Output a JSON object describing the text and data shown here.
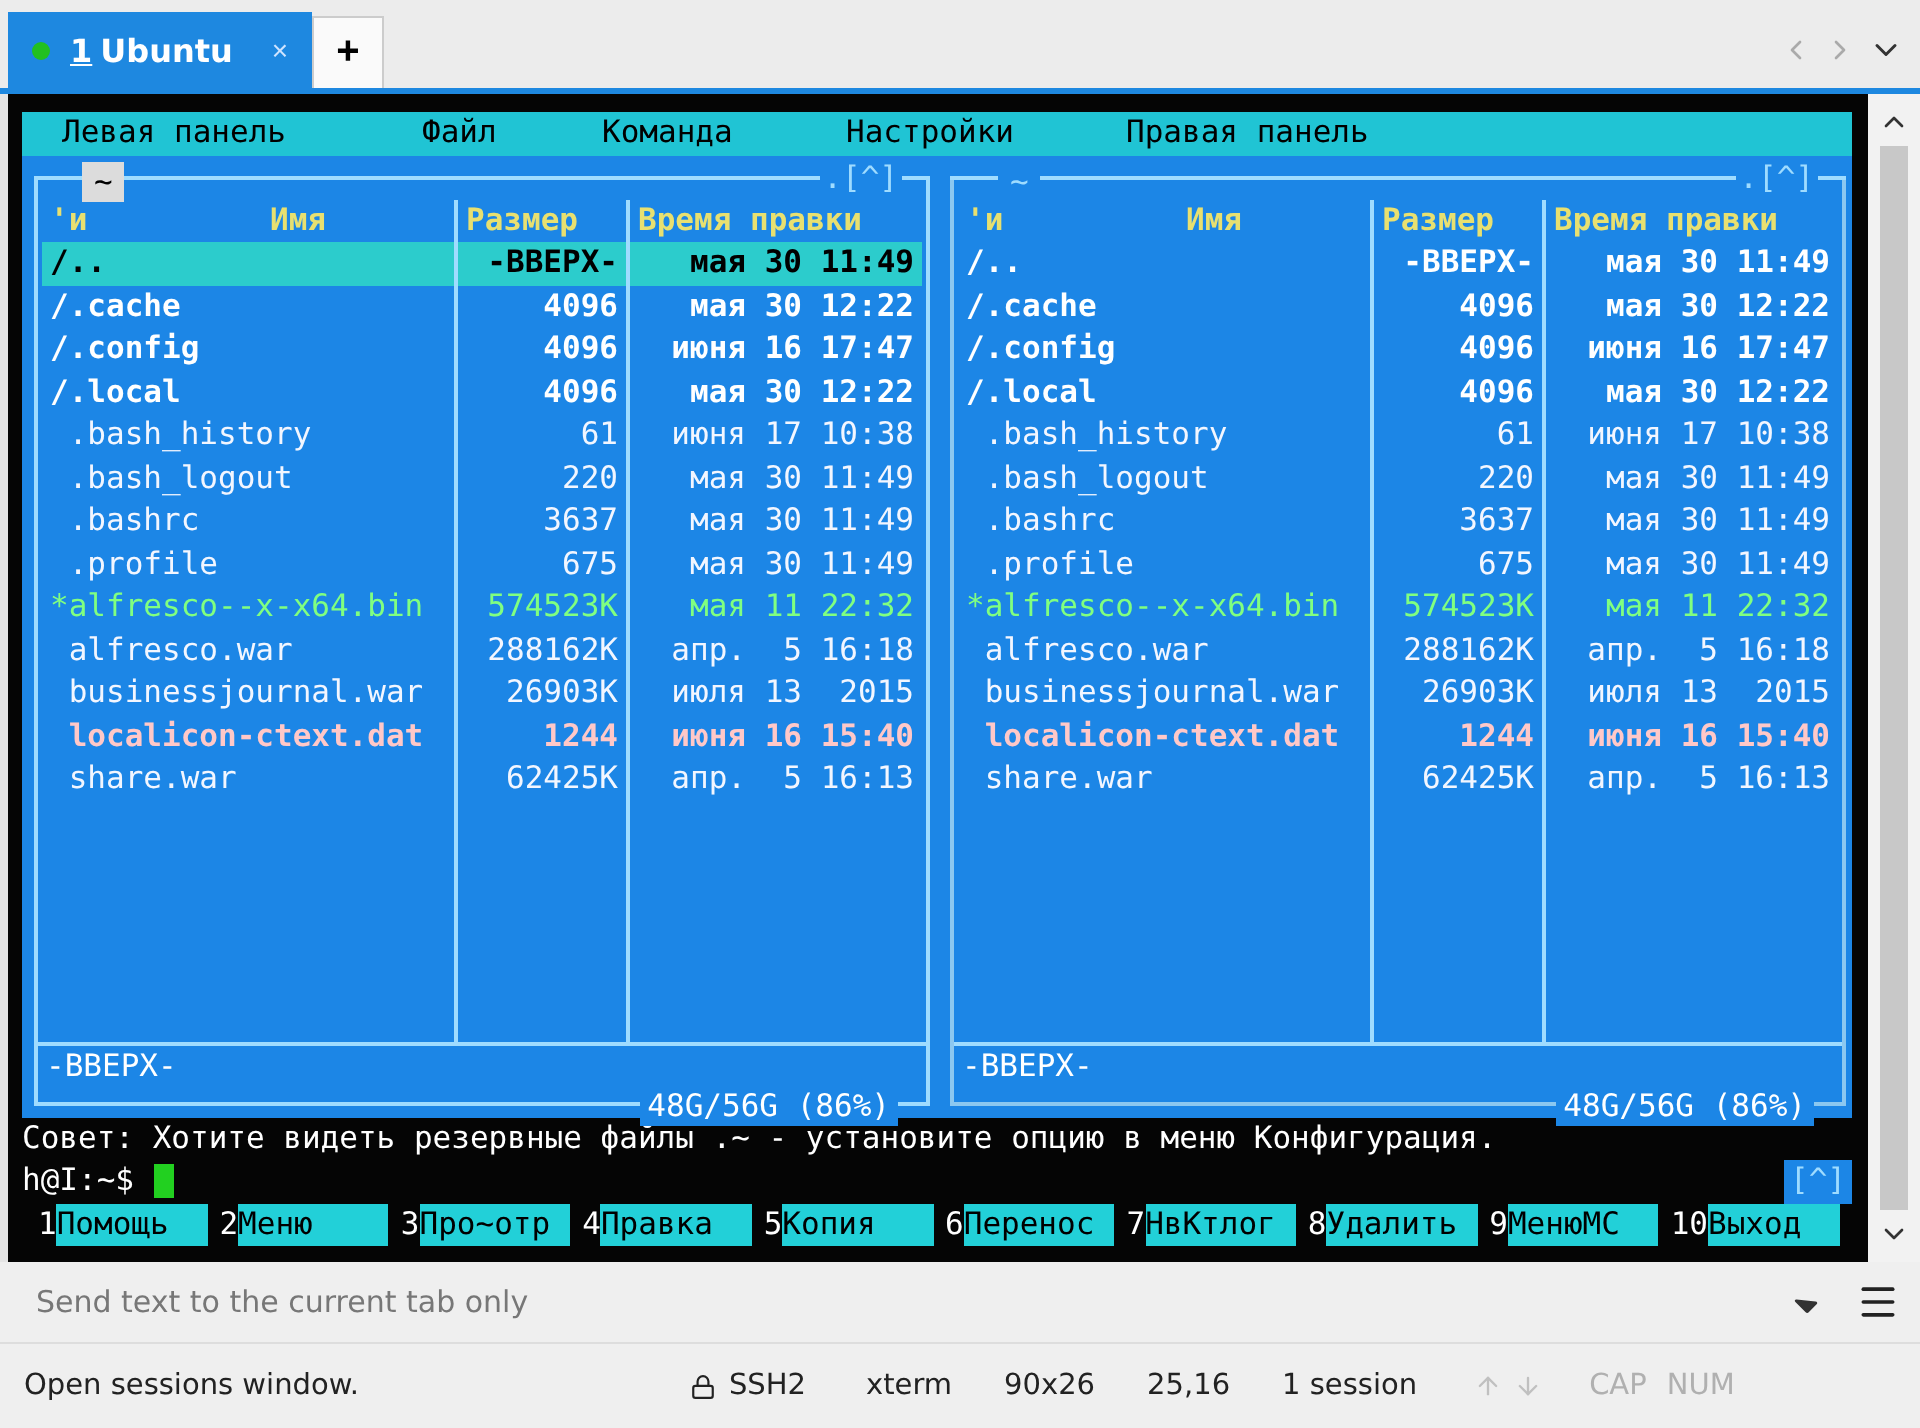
{
  "tab": {
    "index": "1",
    "label": "Ubuntu",
    "close": "×",
    "connected": true
  },
  "new_tab": "+",
  "menu": [
    "Левая панель",
    "Файл",
    "Команда",
    "Настройки",
    "Правая панель"
  ],
  "panels": [
    {
      "active": true,
      "path": "~",
      "corner": ".[^]",
      "columns": [
        "'и",
        "Имя",
        "Размер",
        "Время правки"
      ],
      "footer": "-ВВЕРХ-",
      "disk": "48G/56G (86%)",
      "rows": [
        {
          "kind": "dir",
          "name": "/..",
          "size": "-ВВЕРХ-",
          "time": "мая 30 11:49",
          "selected": true
        },
        {
          "kind": "dir",
          "name": "/.cache",
          "size": "4096",
          "time": "мая 30 12:22",
          "selected": false
        },
        {
          "kind": "dir",
          "name": "/.config",
          "size": "4096",
          "time": "июня 16 17:47",
          "selected": false
        },
        {
          "kind": "dir",
          "name": "/.local",
          "size": "4096",
          "time": "мая 30 12:22",
          "selected": false
        },
        {
          "kind": "file",
          "name": " .bash_history",
          "size": "61",
          "time": "июня 17 10:38",
          "selected": false
        },
        {
          "kind": "file",
          "name": " .bash_logout",
          "size": "220",
          "time": "мая 30 11:49",
          "selected": false
        },
        {
          "kind": "file",
          "name": " .bashrc",
          "size": "3637",
          "time": "мая 30 11:49",
          "selected": false
        },
        {
          "kind": "file",
          "name": " .profile",
          "size": "675",
          "time": "мая 30 11:49",
          "selected": false
        },
        {
          "kind": "exec",
          "name": "*alfresco--x-x64.bin",
          "size": "574523K",
          "time": "мая 11 22:32",
          "selected": false
        },
        {
          "kind": "file",
          "name": " alfresco.war",
          "size": "288162K",
          "time": "апр.  5 16:18",
          "selected": false
        },
        {
          "kind": "file",
          "name": " businessjournal.war",
          "size": "26903K",
          "time": "июля 13  2015",
          "selected": false
        },
        {
          "kind": "broken",
          "name": " localicon-ctext.dat",
          "size": "1244",
          "time": "июня 16 15:40",
          "selected": false
        },
        {
          "kind": "file",
          "name": " share.war",
          "size": "62425K",
          "time": "апр.  5 16:13",
          "selected": false
        }
      ]
    },
    {
      "active": false,
      "path": "~",
      "corner": ".[^]",
      "columns": [
        "'и",
        "Имя",
        "Размер",
        "Время правки"
      ],
      "footer": "-ВВЕРХ-",
      "disk": "48G/56G (86%)",
      "rows": [
        {
          "kind": "dir",
          "name": "/..",
          "size": "-ВВЕРХ-",
          "time": "мая 30 11:49",
          "selected": false
        },
        {
          "kind": "dir",
          "name": "/.cache",
          "size": "4096",
          "time": "мая 30 12:22",
          "selected": false
        },
        {
          "kind": "dir",
          "name": "/.config",
          "size": "4096",
          "time": "июня 16 17:47",
          "selected": false
        },
        {
          "kind": "dir",
          "name": "/.local",
          "size": "4096",
          "time": "мая 30 12:22",
          "selected": false
        },
        {
          "kind": "file",
          "name": " .bash_history",
          "size": "61",
          "time": "июня 17 10:38",
          "selected": false
        },
        {
          "kind": "file",
          "name": " .bash_logout",
          "size": "220",
          "time": "мая 30 11:49",
          "selected": false
        },
        {
          "kind": "file",
          "name": " .bashrc",
          "size": "3637",
          "time": "мая 30 11:49",
          "selected": false
        },
        {
          "kind": "file",
          "name": " .profile",
          "size": "675",
          "time": "мая 30 11:49",
          "selected": false
        },
        {
          "kind": "exec",
          "name": "*alfresco--x-x64.bin",
          "size": "574523K",
          "time": "мая 11 22:32",
          "selected": false
        },
        {
          "kind": "file",
          "name": " alfresco.war",
          "size": "288162K",
          "time": "апр.  5 16:18",
          "selected": false
        },
        {
          "kind": "file",
          "name": " businessjournal.war",
          "size": "26903K",
          "time": "июля 13  2015",
          "selected": false
        },
        {
          "kind": "broken",
          "name": " localicon-ctext.dat",
          "size": "1244",
          "time": "июня 16 15:40",
          "selected": false
        },
        {
          "kind": "file",
          "name": " share.war",
          "size": "62425K",
          "time": "апр.  5 16:13",
          "selected": false
        }
      ]
    }
  ],
  "hint": "Совет: Хотите видеть резервные файлы .~ - установите опцию в меню Конфигурация.",
  "prompt": "h@I:~$",
  "prompt_corner": "[^]",
  "fkeys": [
    {
      "num": "1",
      "label": "Помощь"
    },
    {
      "num": "2",
      "label": "Меню"
    },
    {
      "num": "3",
      "label": "Про~отр"
    },
    {
      "num": "4",
      "label": "Правка"
    },
    {
      "num": "5",
      "label": "Копия"
    },
    {
      "num": "6",
      "label": "Перенос"
    },
    {
      "num": "7",
      "label": "НвКтлог"
    },
    {
      "num": "8",
      "label": "Удалить"
    },
    {
      "num": "9",
      "label": "МенюМС"
    },
    {
      "num": "10",
      "label": "Выход"
    }
  ],
  "send_bar": {
    "placeholder": "Send text to the current tab only"
  },
  "status": {
    "message": "Open sessions window.",
    "protocol": "SSH2",
    "term": "xterm",
    "size": "90x26",
    "cursor": "25,16",
    "sessions": "1 session",
    "cap": "CAP",
    "num": "NUM"
  }
}
